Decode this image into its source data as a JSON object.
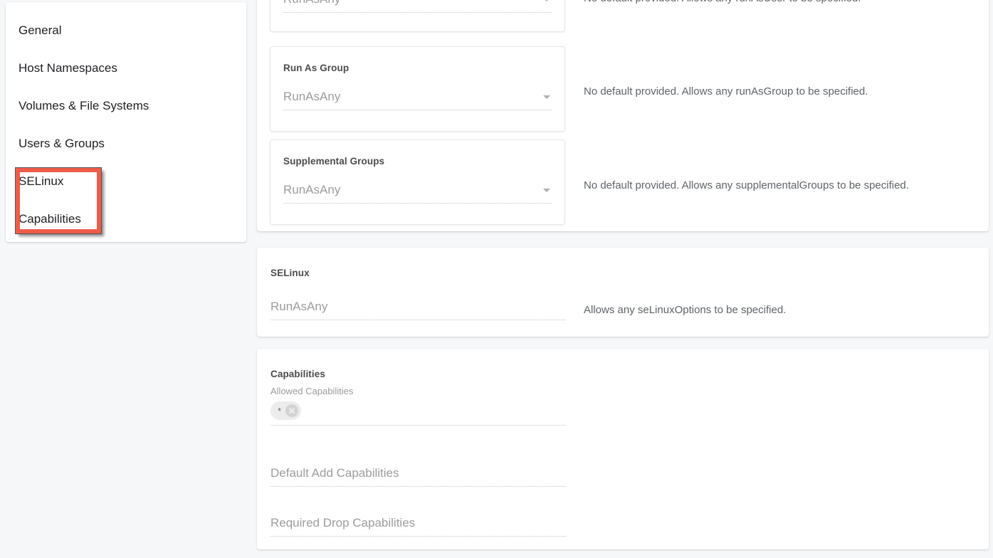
{
  "sidebar": {
    "items": [
      {
        "label": "General"
      },
      {
        "label": "Host Namespaces"
      },
      {
        "label": "Volumes & File Systems"
      },
      {
        "label": "Users & Groups"
      },
      {
        "label": "SELinux"
      },
      {
        "label": "Capabilities"
      }
    ],
    "highlight_color": "#ef5c4a"
  },
  "users_groups": {
    "run_as_user": {
      "value": "RunAsAny",
      "description": "No default provided. Allows any runAsUser to be specified."
    },
    "run_as_group": {
      "title": "Run As Group",
      "value": "RunAsAny",
      "description": "No default provided. Allows any runAsGroup to be specified."
    },
    "supplemental_groups": {
      "title": "Supplemental Groups",
      "value": "RunAsAny",
      "description": "No default provided. Allows any supplementalGroups to be specified."
    }
  },
  "selinux": {
    "title": "SELinux",
    "value": "RunAsAny",
    "description": "Allows any seLinuxOptions to be specified."
  },
  "capabilities": {
    "title": "Capabilities",
    "allowed_label": "Allowed Capabilities",
    "allowed_chips": [
      "*"
    ],
    "default_add_placeholder": "Default Add Capabilities",
    "required_drop_placeholder": "Required Drop Capabilities"
  }
}
